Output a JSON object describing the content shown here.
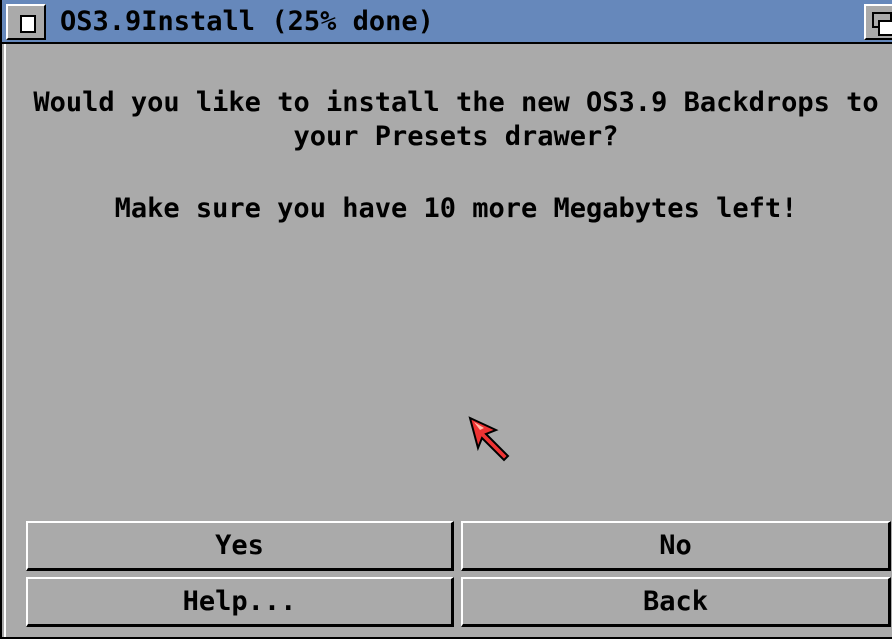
{
  "window": {
    "title": "OS3.9Install (25% done)",
    "progress_percent": 25
  },
  "dialog": {
    "question": "Would you like to install the new OS3.9 Backdrops to\nyour Presets drawer?",
    "warning": "Make sure you have 10 more Megabytes left!"
  },
  "buttons": {
    "yes": "Yes",
    "no": "No",
    "help": "Help...",
    "back": "Back"
  },
  "icons": {
    "close": "close-icon",
    "depth": "depth-arrange-icon",
    "pointer": "mouse-pointer-icon"
  },
  "colors": {
    "titlebar": "#6688bb",
    "window_background": "#aaaaaa",
    "pointer": "#ee3333"
  }
}
